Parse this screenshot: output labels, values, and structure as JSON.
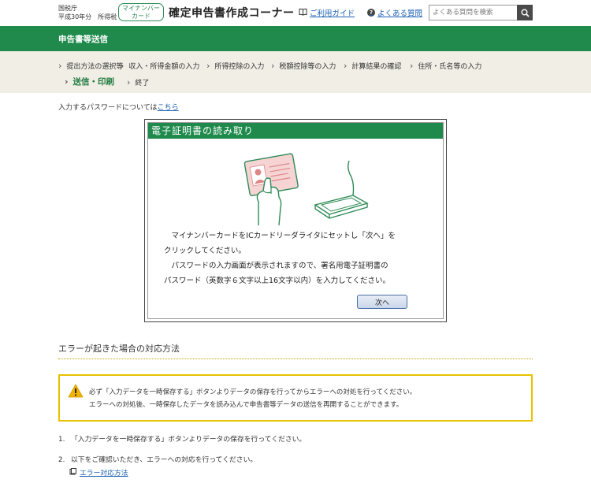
{
  "header": {
    "agency_line1": "国税庁",
    "agency_line2": "平成30年分　所得税",
    "mynumber_line1": "マイナンバー",
    "mynumber_line2": "カード",
    "site_title": "確定申告書作成コーナー",
    "guide_link": "ご利用ガイド",
    "faq_link": "よくある質問",
    "faq_icon_glyph": "?",
    "search_placeholder": "よくある質問を検索"
  },
  "band": {
    "title": "申告書等送信"
  },
  "steps": [
    {
      "label": "提出方法の選択等"
    },
    {
      "label": "収入・所得金額の入力"
    },
    {
      "label": "所得控除の入力"
    },
    {
      "label": "税額控除等の入力"
    },
    {
      "label": "計算結果の確認"
    },
    {
      "label": "住所・氏名等の入力"
    },
    {
      "label": "送信・印刷",
      "active": true
    },
    {
      "label": "終了"
    }
  ],
  "main": {
    "pw_note_prefix": "入力するパスワードについては",
    "pw_note_link": "こちら",
    "dialog": {
      "title": "電子証明書の読み取り",
      "lines": [
        "　マイナンバーカードをICカードリーダライタにセットし「次へ」を",
        "クリックしてください。",
        "　パスワードの入力画面が表示されますので、署名用電子証明書の",
        "パスワード（英数字６文字以上16文字以内）を入力してください。"
      ],
      "next_button": "次へ"
    },
    "section_title": "エラーが起きた場合の対応方法",
    "warning": {
      "line1": "必ず「入力データを一時保存する」ボタンよりデータの保存を行ってからエラーへの対処を行ってください。",
      "line2": "エラーへの対処後、一時保存したデータを読み込んで申告書等データの送信を再開することができます。"
    },
    "list": [
      {
        "num": "1.",
        "text": "「入力データを一時保存する」ボタンよりデータの保存を行ってください。"
      },
      {
        "num": "2.",
        "text": "以下をご確認いただき、エラーへの対応を行ってください。"
      }
    ],
    "sublink": "エラー対応方法"
  },
  "colors": {
    "green": "#1f8a4c",
    "link": "#1a5fb4",
    "warning_border": "#e8c200"
  }
}
